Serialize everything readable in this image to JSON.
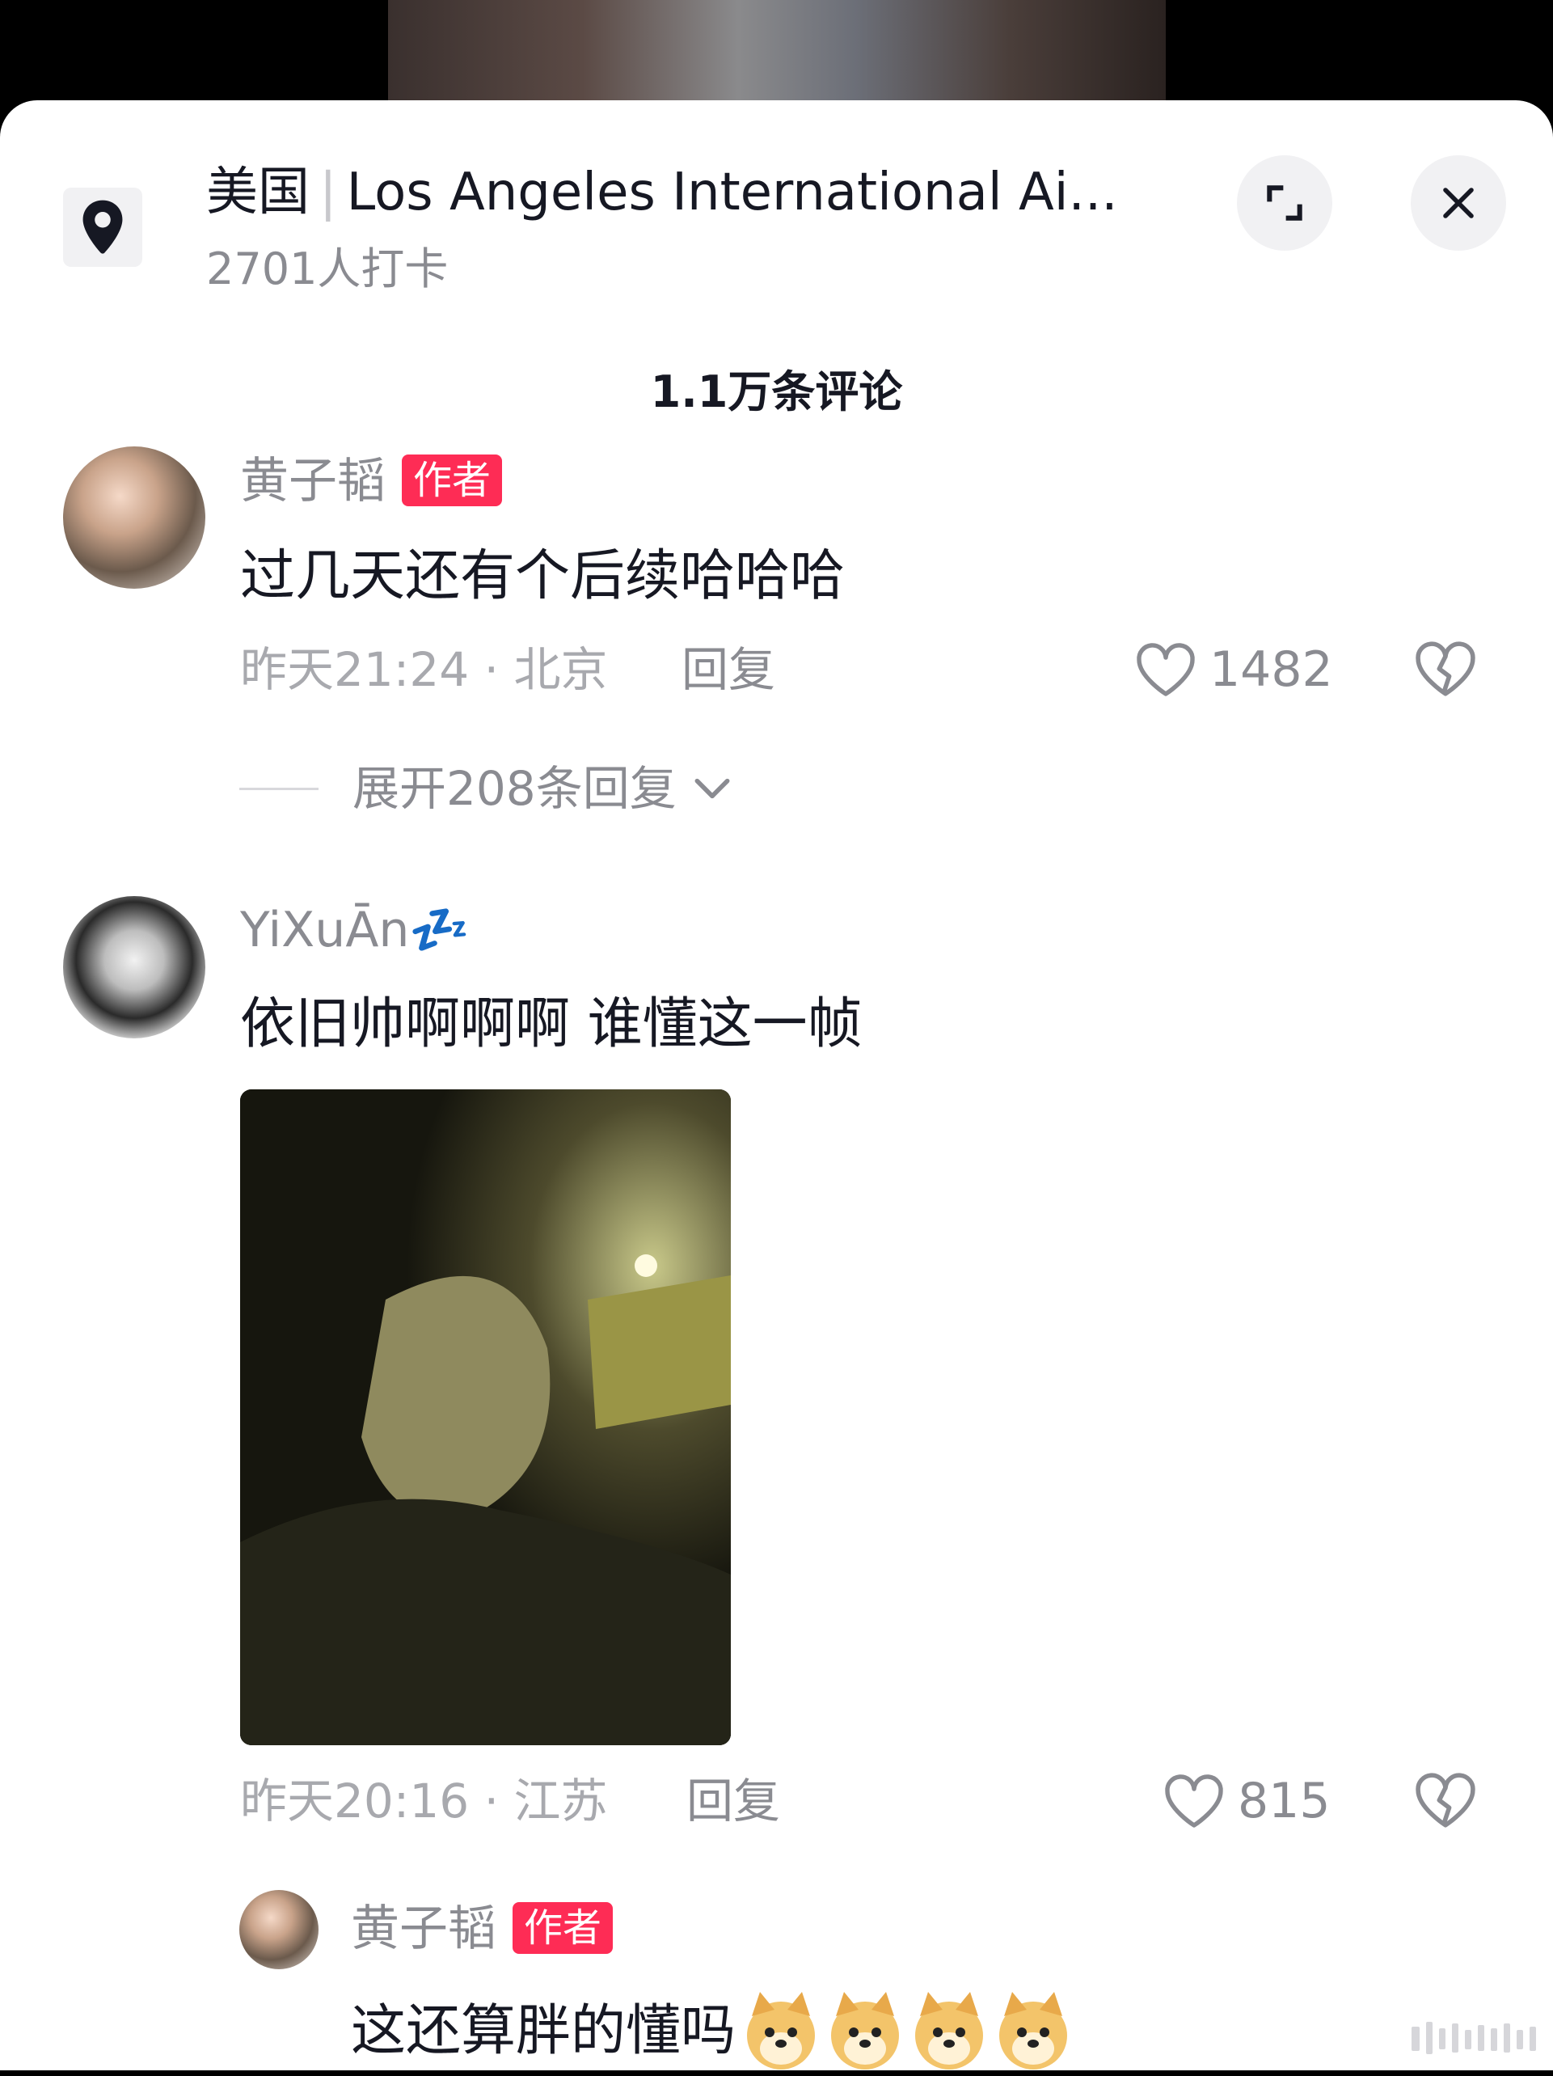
{
  "location": {
    "country": "美国",
    "place": "Los Angeles International Ai...",
    "checkins": "2701人打卡"
  },
  "comments_header": "1.1万条评论",
  "comments": [
    {
      "username": "黄子韬",
      "badge": "作者",
      "text": "过几天还有个后续哈哈哈",
      "time_loc": "昨天21:24 · 北京",
      "reply": "回复",
      "likes": "1482",
      "expand": "展开208条回复"
    },
    {
      "username": "YiXuĀn💤",
      "text": "依旧帅啊啊啊 谁懂这一帧",
      "time_loc": "昨天20:16 · 江苏",
      "reply": "回复",
      "likes": "815"
    }
  ],
  "reply": {
    "username": "黄子韬",
    "badge": "作者",
    "text": "这还算胖的懂吗"
  },
  "icons": {
    "location": "location-pin-icon",
    "expand": "expand-icon",
    "close": "close-icon",
    "like": "heart-icon",
    "dislike": "broken-heart-icon",
    "emoji": "dog-emoji-icon"
  },
  "colors": {
    "author_badge": "#fe2c55",
    "text_primary": "#161823",
    "text_secondary": "#8a8b91"
  }
}
